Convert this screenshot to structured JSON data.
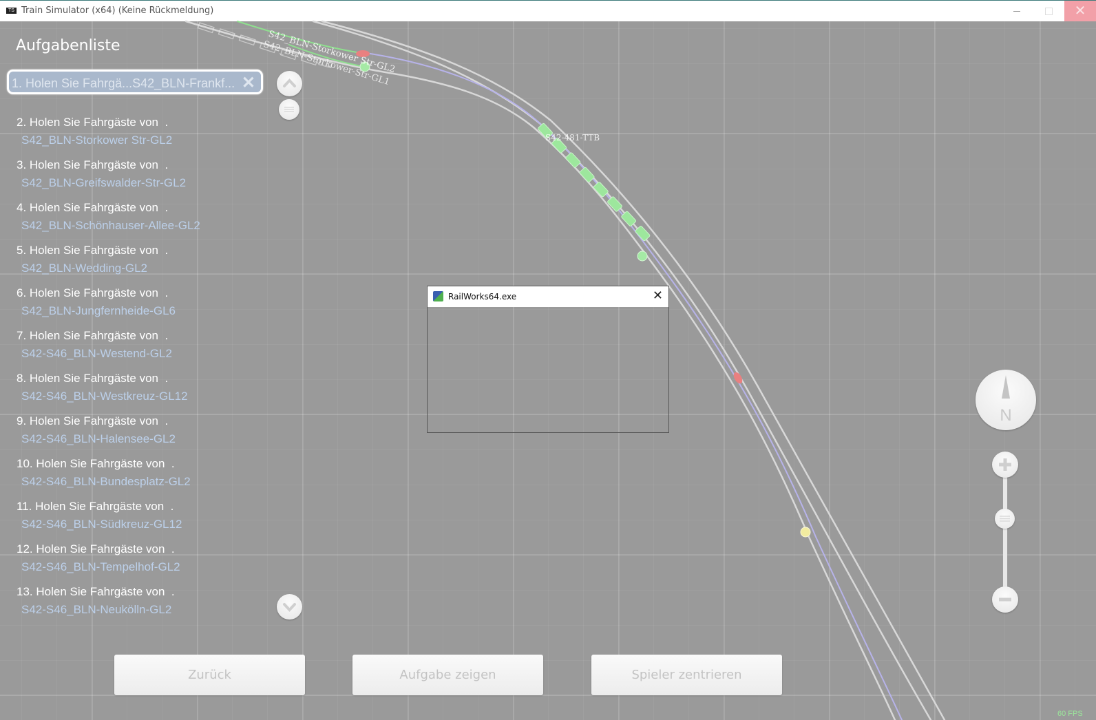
{
  "window": {
    "title": "Train Simulator (x64) (Keine Rückmeldung)",
    "app_icon": "TS",
    "close_glyph": "✕"
  },
  "panel": {
    "title": "Aufgabenliste",
    "selected_task": "1. Holen Sie Fahrgä...S42_BLN-Frankf...",
    "tasks": [
      {
        "line": "2. Holen Sie Fahrgäste von  .",
        "station": "S42_BLN-Storkower Str-GL2"
      },
      {
        "line": "3. Holen Sie Fahrgäste von  .",
        "station": "S42_BLN-Greifswalder-Str-GL2"
      },
      {
        "line": "4. Holen Sie Fahrgäste von  .",
        "station": "S42_BLN-Schönhauser-Allee-GL2"
      },
      {
        "line": "5. Holen Sie Fahrgäste von  .",
        "station": "S42_BLN-Wedding-GL2"
      },
      {
        "line": "6. Holen Sie Fahrgäste von  .",
        "station": "S42_BLN-Jungfernheide-GL6"
      },
      {
        "line": "7. Holen Sie Fahrgäste von  .",
        "station": "S42-S46_BLN-Westend-GL2"
      },
      {
        "line": "8. Holen Sie Fahrgäste von  .",
        "station": "S42-S46_BLN-Westkreuz-GL12"
      },
      {
        "line": "9. Holen Sie Fahrgäste von  .",
        "station": "S42-S46_BLN-Halensee-GL2"
      },
      {
        "line": "10. Holen Sie Fahrgäste von  .",
        "station": "S42-S46_BLN-Bundesplatz-GL2"
      },
      {
        "line": "11. Holen Sie Fahrgäste von  .",
        "station": "S42-S46_BLN-Südkreuz-GL12"
      },
      {
        "line": "12. Holen Sie Fahrgäste von  .",
        "station": "S42-S46_BLN-Tempelhof-GL2"
      },
      {
        "line": "13. Holen Sie Fahrgäste von  .",
        "station": "S42-S46_BLN-Neukölln-GL2"
      }
    ]
  },
  "buttons": {
    "back": "Zurück",
    "show_task": "Aufgabe zeigen",
    "center_player": "Spieler zentrieren"
  },
  "dialog": {
    "title": "RailWorks64.exe",
    "close_glyph": "✕"
  },
  "map": {
    "labels": {
      "station_gl2": "S42_BLN-Storkower Str-GL2",
      "station_gl1": "S42_BLN-Storkower-Str-GL1",
      "train": "S42-481-TTB"
    },
    "compass_letter": "N",
    "fps": "60 FPS",
    "colors": {
      "track": "#d8d8d8",
      "route": "#b7b3ea",
      "train": "#9de79d",
      "signal_red": "#e98080",
      "marker_yellow": "#f2eca0"
    }
  }
}
